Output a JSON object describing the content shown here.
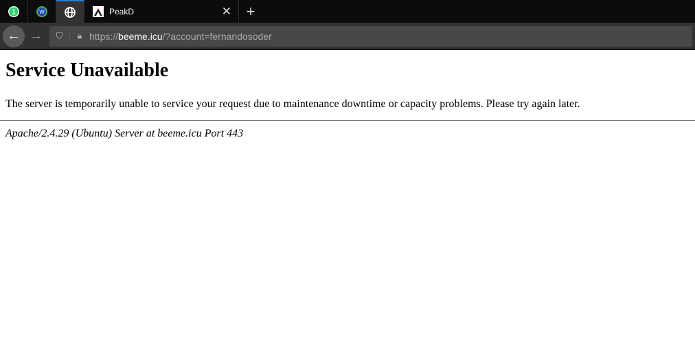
{
  "tabs": [
    {
      "icon": "whatsapp-icon",
      "badge": "1"
    },
    {
      "icon": "hive-icon"
    },
    {
      "icon": "globe-icon",
      "active": true
    },
    {
      "icon": "peakd-icon",
      "label": "PeakD"
    }
  ],
  "toolbar": {
    "url_scheme": "https://",
    "url_host": "beeme.icu",
    "url_path": "/?account=fernandosoder"
  },
  "page": {
    "title": "Service Unavailable",
    "message": "The server is temporarily unable to service your request due to maintenance downtime or capacity problems. Please try again later.",
    "footer": "Apache/2.4.29 (Ubuntu) Server at beeme.icu Port 443"
  },
  "colors": {
    "accent": "#0a84ff"
  }
}
